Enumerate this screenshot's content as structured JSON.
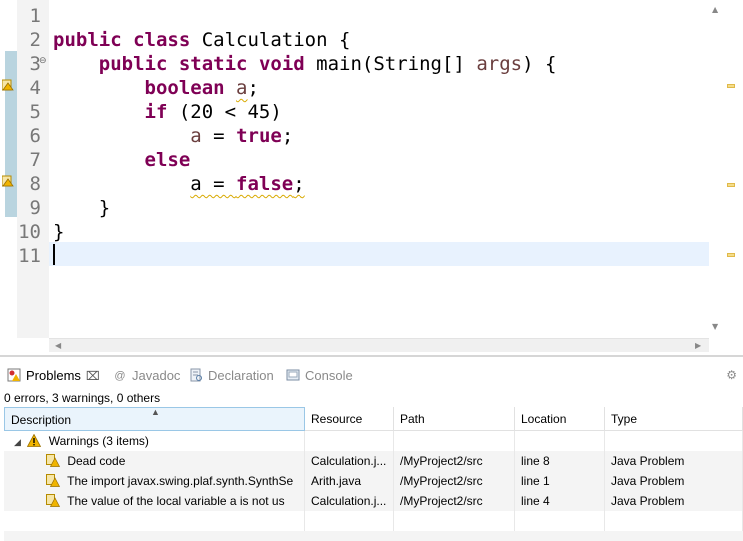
{
  "editor": {
    "line_numbers": [
      "1",
      "2",
      "3",
      "4",
      "5",
      "6",
      "7",
      "8",
      "9",
      "10",
      "11"
    ],
    "fold_marker": "⊖",
    "lines": [
      {
        "tokens": []
      },
      {
        "tokens": [
          {
            "t": "public",
            "k": "kw"
          },
          {
            "t": " "
          },
          {
            "t": "class",
            "k": "kw"
          },
          {
            "t": " Calculation {"
          }
        ]
      },
      {
        "tokens": [
          {
            "t": "    "
          },
          {
            "t": "public",
            "k": "kw"
          },
          {
            "t": " "
          },
          {
            "t": "static",
            "k": "kw"
          },
          {
            "t": " "
          },
          {
            "t": "void",
            "k": "kw"
          },
          {
            "t": " main(String[] "
          },
          {
            "t": "args",
            "k": "var"
          },
          {
            "t": ") {"
          }
        ]
      },
      {
        "tokens": [
          {
            "t": "        "
          },
          {
            "t": "boolean",
            "k": "kw"
          },
          {
            "t": " "
          },
          {
            "t": "a",
            "k": "var squig"
          },
          {
            "t": ";"
          }
        ]
      },
      {
        "tokens": [
          {
            "t": "        "
          },
          {
            "t": "if",
            "k": "kw"
          },
          {
            "t": " (20 < 45)"
          }
        ]
      },
      {
        "tokens": [
          {
            "t": "            "
          },
          {
            "t": "a",
            "k": "var"
          },
          {
            "t": " = "
          },
          {
            "t": "true",
            "k": "kw"
          },
          {
            "t": ";"
          }
        ]
      },
      {
        "tokens": [
          {
            "t": "        "
          },
          {
            "t": "else",
            "k": "kw"
          }
        ]
      },
      {
        "tokens": [
          {
            "t": "            "
          },
          {
            "t": "a = ",
            "k": "squig"
          },
          {
            "t": "false",
            "k": "kw squig"
          },
          {
            "t": ";",
            "k": "squig"
          }
        ]
      },
      {
        "tokens": [
          {
            "t": "    }"
          }
        ]
      },
      {
        "tokens": [
          {
            "t": "}"
          }
        ]
      },
      {
        "tokens": []
      }
    ]
  },
  "views": {
    "tabs": [
      {
        "label": "Problems",
        "icon": "problems-icon",
        "active": true
      },
      {
        "label": "Javadoc",
        "icon": "javadoc-icon",
        "active": false
      },
      {
        "label": "Declaration",
        "icon": "declaration-icon",
        "active": false
      },
      {
        "label": "Console",
        "icon": "console-icon",
        "active": false
      }
    ],
    "close_glyph": "⌧",
    "menu_glyph": "⚙"
  },
  "problems": {
    "summary": "0 errors, 3 warnings, 0 others",
    "columns": [
      "Description",
      "Resource",
      "Path",
      "Location",
      "Type"
    ],
    "group": {
      "label": "Warnings (3 items)",
      "toggle": "◢"
    },
    "rows": [
      {
        "description": "Dead code",
        "resource": "Calculation.j...",
        "path": "/MyProject2/src",
        "location": "line 8",
        "type": "Java Problem"
      },
      {
        "description": "The import javax.swing.plaf.synth.SynthSe",
        "resource": "Arith.java",
        "path": "/MyProject2/src",
        "location": "line 1",
        "type": "Java Problem"
      },
      {
        "description": "The value of the local variable a is not us",
        "resource": "Calculation.j...",
        "path": "/MyProject2/src",
        "location": "line 4",
        "type": "Java Problem"
      }
    ]
  },
  "colors": {
    "keyword": "#7f0055",
    "variable": "#6a3e3e",
    "warning": "#f0b400",
    "current_line": "#e8f2fe"
  }
}
